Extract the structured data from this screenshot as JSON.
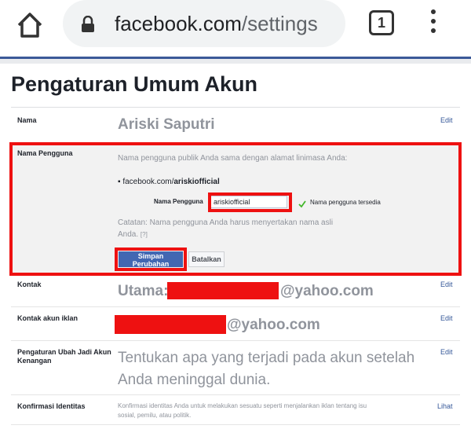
{
  "browser": {
    "url_domain": "facebook.com",
    "url_path": "/settings",
    "tab_count": "1"
  },
  "page": {
    "title": "Pengaturan Umum Akun"
  },
  "rows": {
    "name": {
      "label": "Nama",
      "value": "Ariski Saputri",
      "action": "Edit"
    },
    "username": {
      "label": "Nama Pengguna",
      "description": "Nama pengguna publik Anda sama dengan alamat linimasa Anda:",
      "url_prefix": "facebook.com/",
      "url_user": "ariskiofficial",
      "field_label": "Nama Pengguna",
      "field_value": "ariskiofficial",
      "availability": "Nama pengguna tersedia",
      "note": "Catatan: Nama pengguna Anda harus menyertakan nama asli Anda.",
      "note_help": "[?]",
      "save_label": "Simpan Perubahan",
      "cancel_label": "Batalkan"
    },
    "contact": {
      "label": "Kontak",
      "prefix": "Utama:",
      "suffix": "@yahoo.com",
      "action": "Edit"
    },
    "ad_contact": {
      "label": "Kontak akun iklan",
      "suffix": "@yahoo.com",
      "action": "Edit"
    },
    "memorial": {
      "label": "Pengaturan Ubah Jadi Akun Kenangan",
      "value": "Tentukan apa yang terjadi pada akun setelah Anda meninggal dunia.",
      "action": "Edit"
    },
    "identity": {
      "label": "Konfirmasi Identitas",
      "value": "Konfirmasi identitas Anda untuk melakukan sesuatu seperti menjalankan iklan tentang isu sosial, pemilu, atau politik.",
      "action": "Lihat"
    }
  },
  "colors": {
    "accent": "#3b5998",
    "button": "#4267b2",
    "redaction": "#ee1111",
    "link": "#365899"
  }
}
